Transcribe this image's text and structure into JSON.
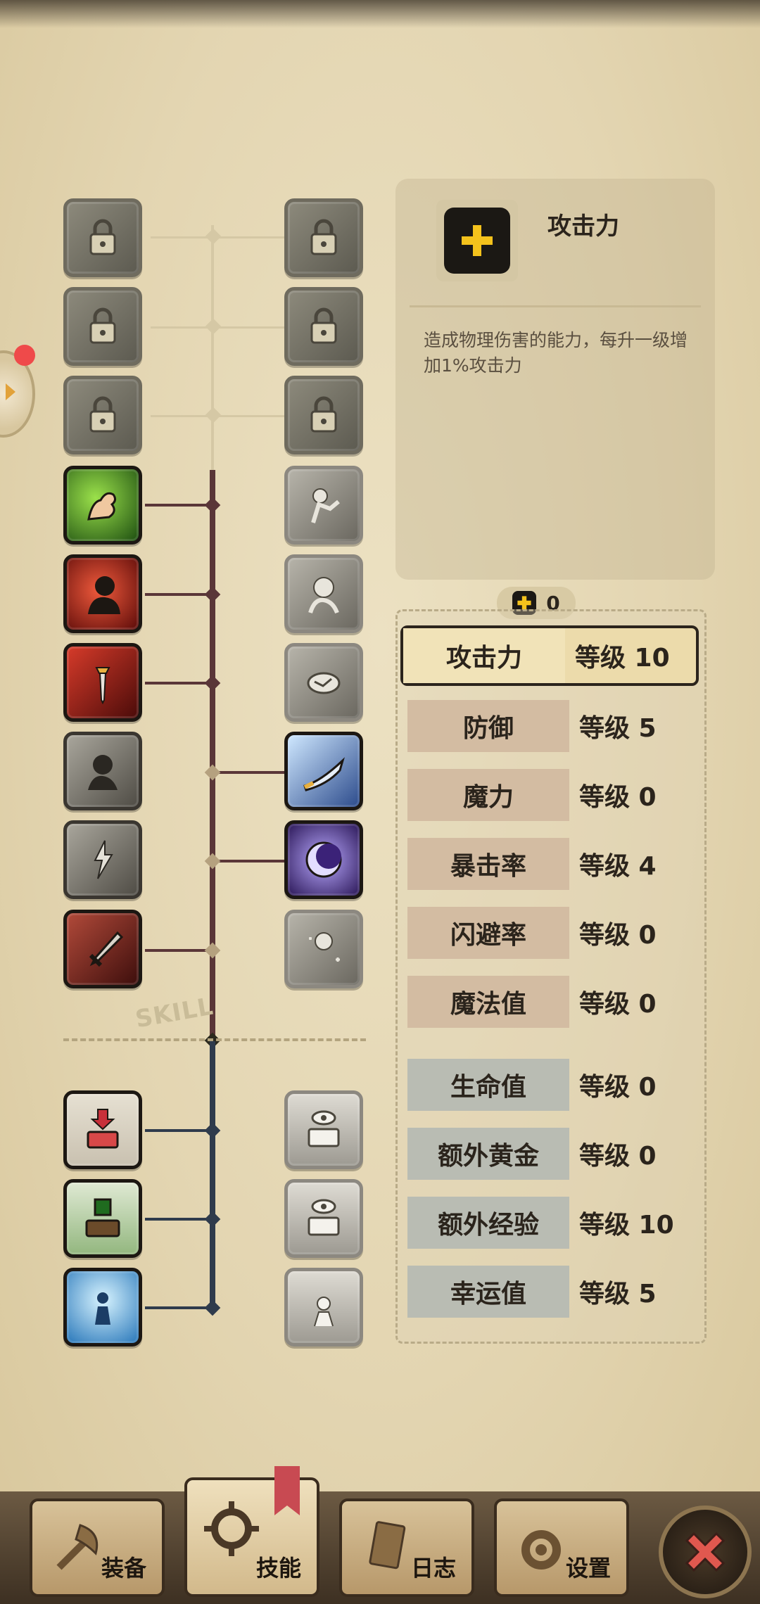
{
  "detail": {
    "title": "攻击力",
    "description": "造成物理伤害的能力，每升一级增加1%攻击力"
  },
  "points": {
    "value": "0"
  },
  "stats": [
    {
      "name": "攻击力",
      "level": "等级 10",
      "group": "combat",
      "selected": true
    },
    {
      "name": "防御",
      "level": "等级 5",
      "group": "combat",
      "selected": false
    },
    {
      "name": "魔力",
      "level": "等级 0",
      "group": "combat",
      "selected": false
    },
    {
      "name": "暴击率",
      "level": "等级 4",
      "group": "combat",
      "selected": false
    },
    {
      "name": "闪避率",
      "level": "等级 0",
      "group": "combat",
      "selected": false
    },
    {
      "name": "魔法值",
      "level": "等级 0",
      "group": "combat",
      "selected": false
    },
    {
      "name": "生命值",
      "level": "等级 0",
      "group": "economy",
      "selected": false
    },
    {
      "name": "额外黄金",
      "level": "等级 0",
      "group": "economy",
      "selected": false
    },
    {
      "name": "额外经验",
      "level": "等级 10",
      "group": "economy",
      "selected": false
    },
    {
      "name": "幸运值",
      "level": "等级 5",
      "group": "economy",
      "selected": false
    }
  ],
  "tree": {
    "skill_label": "SKILL"
  },
  "nav": {
    "equipment": "装备",
    "skills": "技能",
    "log": "日志",
    "settings": "设置"
  },
  "colors": {
    "accent_yellow": "#f4c21c",
    "close_red": "#e0584f",
    "tree_red": "#5a3638",
    "tree_blue": "#2f3b4c"
  }
}
